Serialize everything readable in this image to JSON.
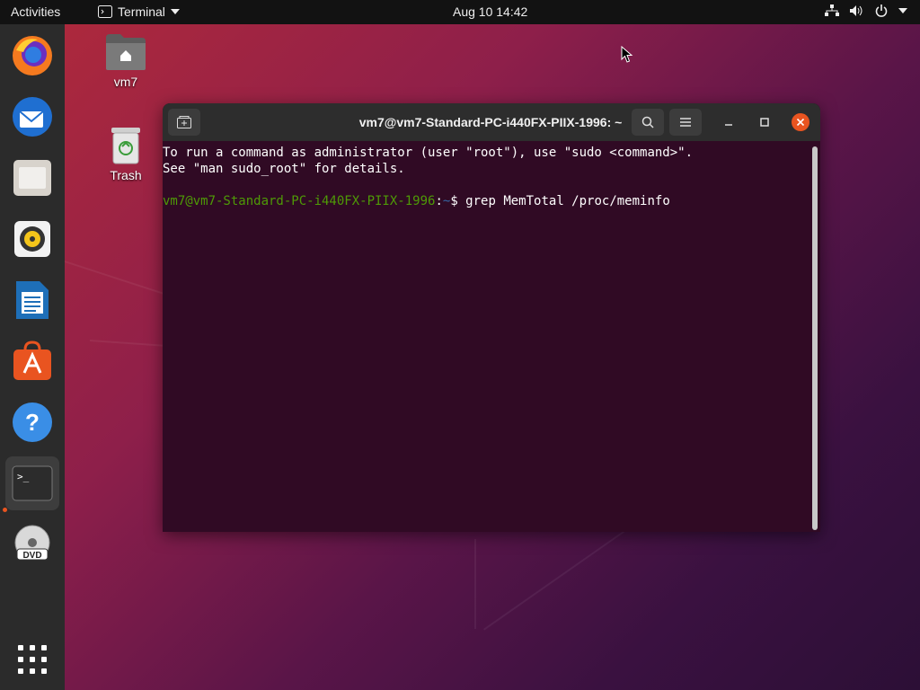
{
  "topbar": {
    "activities": "Activities",
    "app_name": "Terminal",
    "clock": "Aug 10  14:42"
  },
  "desktop": {
    "icons": [
      {
        "label": "vm7",
        "icon": "home-folder-icon"
      },
      {
        "label": "Trash",
        "icon": "trash-icon"
      }
    ]
  },
  "dock": {
    "items": [
      "Firefox",
      "Thunderbird",
      "Files",
      "Rhythmbox",
      "LibreOffice Writer",
      "Ubuntu Software",
      "Help",
      "Terminal",
      "DVD"
    ],
    "active": "Terminal"
  },
  "terminal": {
    "title": "vm7@vm7-Standard-PC-i440FX-PIIX-1996: ~",
    "line1": "To run a command as administrator (user \"root\"), use \"sudo <command>\".",
    "line2": "See \"man sudo_root\" for details.",
    "prompt_user": "vm7@vm7-Standard-PC-i440FX-PIIX-1996",
    "prompt_sep": ":",
    "prompt_path": "~",
    "prompt_symbol": "$ ",
    "command": "grep MemTotal /proc/meminfo"
  },
  "colors": {
    "terminal_bg": "#300a24",
    "prompt_user": "#4e9a06",
    "prompt_path": "#3465a4",
    "accent": "#e95420"
  }
}
